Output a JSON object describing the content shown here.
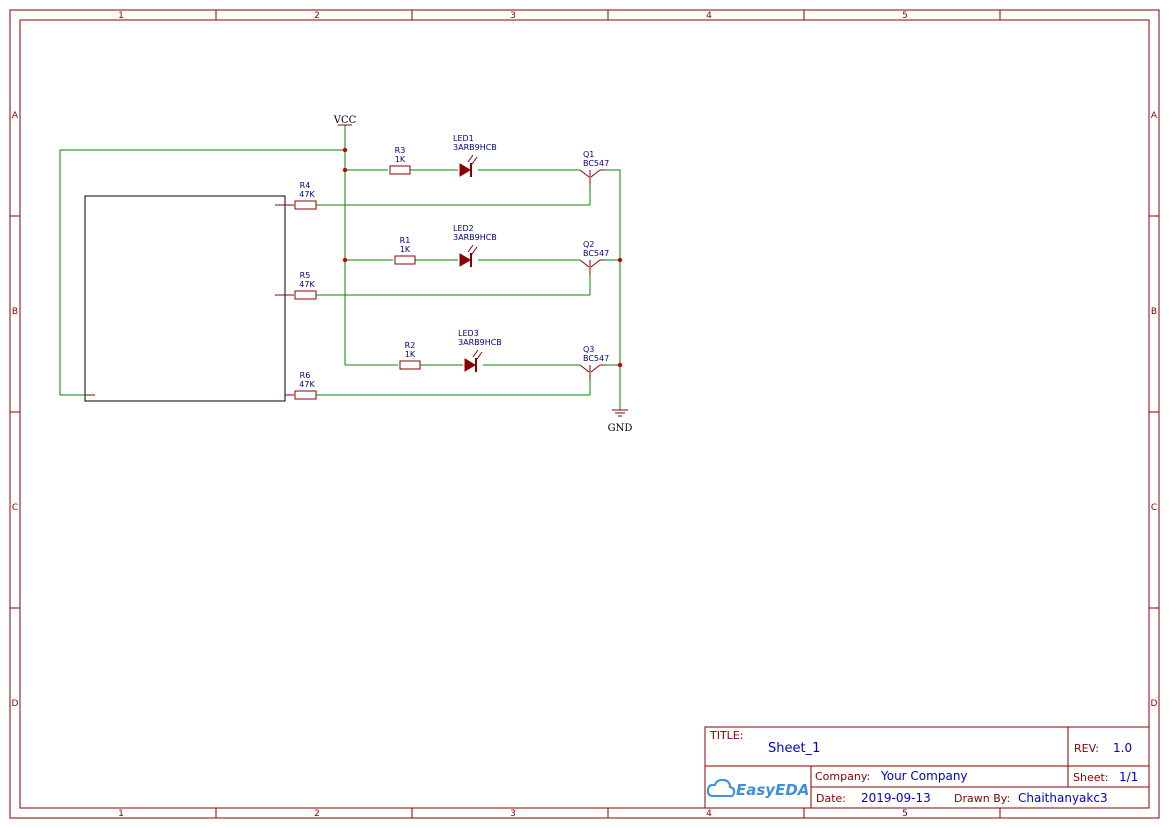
{
  "grid": {
    "columns": [
      "1",
      "2",
      "3",
      "4",
      "5"
    ],
    "rows": [
      "A",
      "B",
      "C",
      "D"
    ]
  },
  "power": {
    "vcc": "VCC",
    "gnd": "GND"
  },
  "components": {
    "r1": {
      "ref": "R1",
      "value": "1K"
    },
    "r2": {
      "ref": "R2",
      "value": "1K"
    },
    "r3": {
      "ref": "R3",
      "value": "1K"
    },
    "r4": {
      "ref": "R4",
      "value": "47K"
    },
    "r5": {
      "ref": "R5",
      "value": "47K"
    },
    "r6": {
      "ref": "R6",
      "value": "47K"
    },
    "led1": {
      "ref": "LED1",
      "value": "3ARB9HCB"
    },
    "led2": {
      "ref": "LED2",
      "value": "3ARB9HCB"
    },
    "led3": {
      "ref": "LED3",
      "value": "3ARB9HCB"
    },
    "q1": {
      "ref": "Q1",
      "value": "BC547"
    },
    "q2": {
      "ref": "Q2",
      "value": "BC547"
    },
    "q3": {
      "ref": "Q3",
      "value": "BC547"
    }
  },
  "title_block": {
    "title_label": "TITLE:",
    "title": "Sheet_1",
    "rev_label": "REV:",
    "rev": "1.0",
    "company_label": "Company:",
    "company": "Your Company",
    "sheet_label": "Sheet:",
    "sheet": "1/1",
    "date_label": "Date:",
    "date": "2019-09-13",
    "drawn_by_label": "Drawn By:",
    "drawn_by": "Chaithanyakc3",
    "logo_text": "EasyEDA"
  },
  "colors": {
    "frame": "#880000",
    "wire": "#008800",
    "label": "#000080",
    "value_text": "#0000cc",
    "logo": "#3d8fe0"
  }
}
